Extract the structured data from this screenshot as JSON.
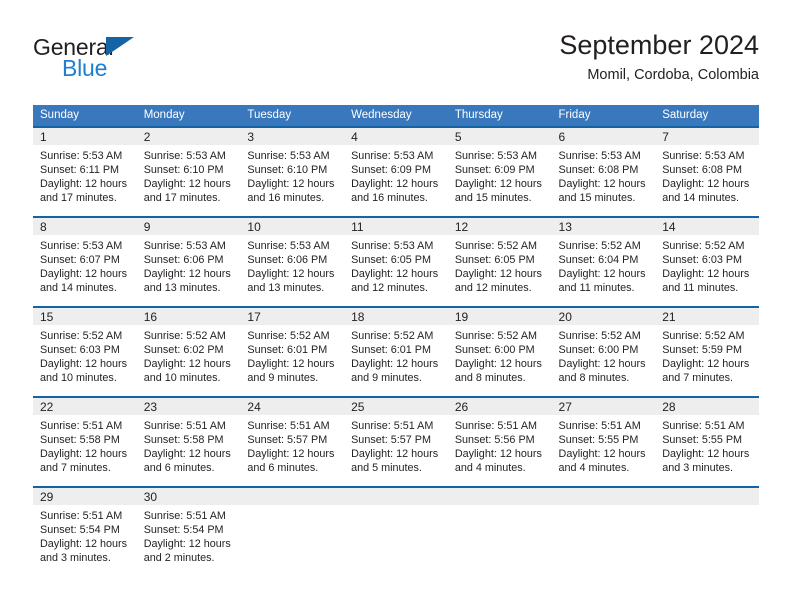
{
  "logo": {
    "text_top": "General",
    "text_bottom": "Blue",
    "triangle_icon": "blue-triangle-icon",
    "color_dark": "#231f20",
    "color_blue": "#1f7ed0"
  },
  "header": {
    "title": "September 2024",
    "subtitle": "Momil, Cordoba, Colombia"
  },
  "theme": {
    "header_row_bg": "#3a78bd",
    "week_separator": "#1464a5",
    "daynum_band_bg": "#eeeeee",
    "text": "#231f20"
  },
  "columns": [
    "Sunday",
    "Monday",
    "Tuesday",
    "Wednesday",
    "Thursday",
    "Friday",
    "Saturday"
  ],
  "weeks": [
    [
      {
        "day": "1",
        "lines": [
          "Sunrise: 5:53 AM",
          "Sunset: 6:11 PM",
          "Daylight: 12 hours",
          "and 17 minutes."
        ]
      },
      {
        "day": "2",
        "lines": [
          "Sunrise: 5:53 AM",
          "Sunset: 6:10 PM",
          "Daylight: 12 hours",
          "and 17 minutes."
        ]
      },
      {
        "day": "3",
        "lines": [
          "Sunrise: 5:53 AM",
          "Sunset: 6:10 PM",
          "Daylight: 12 hours",
          "and 16 minutes."
        ]
      },
      {
        "day": "4",
        "lines": [
          "Sunrise: 5:53 AM",
          "Sunset: 6:09 PM",
          "Daylight: 12 hours",
          "and 16 minutes."
        ]
      },
      {
        "day": "5",
        "lines": [
          "Sunrise: 5:53 AM",
          "Sunset: 6:09 PM",
          "Daylight: 12 hours",
          "and 15 minutes."
        ]
      },
      {
        "day": "6",
        "lines": [
          "Sunrise: 5:53 AM",
          "Sunset: 6:08 PM",
          "Daylight: 12 hours",
          "and 15 minutes."
        ]
      },
      {
        "day": "7",
        "lines": [
          "Sunrise: 5:53 AM",
          "Sunset: 6:08 PM",
          "Daylight: 12 hours",
          "and 14 minutes."
        ]
      }
    ],
    [
      {
        "day": "8",
        "lines": [
          "Sunrise: 5:53 AM",
          "Sunset: 6:07 PM",
          "Daylight: 12 hours",
          "and 14 minutes."
        ]
      },
      {
        "day": "9",
        "lines": [
          "Sunrise: 5:53 AM",
          "Sunset: 6:06 PM",
          "Daylight: 12 hours",
          "and 13 minutes."
        ]
      },
      {
        "day": "10",
        "lines": [
          "Sunrise: 5:53 AM",
          "Sunset: 6:06 PM",
          "Daylight: 12 hours",
          "and 13 minutes."
        ]
      },
      {
        "day": "11",
        "lines": [
          "Sunrise: 5:53 AM",
          "Sunset: 6:05 PM",
          "Daylight: 12 hours",
          "and 12 minutes."
        ]
      },
      {
        "day": "12",
        "lines": [
          "Sunrise: 5:52 AM",
          "Sunset: 6:05 PM",
          "Daylight: 12 hours",
          "and 12 minutes."
        ]
      },
      {
        "day": "13",
        "lines": [
          "Sunrise: 5:52 AM",
          "Sunset: 6:04 PM",
          "Daylight: 12 hours",
          "and 11 minutes."
        ]
      },
      {
        "day": "14",
        "lines": [
          "Sunrise: 5:52 AM",
          "Sunset: 6:03 PM",
          "Daylight: 12 hours",
          "and 11 minutes."
        ]
      }
    ],
    [
      {
        "day": "15",
        "lines": [
          "Sunrise: 5:52 AM",
          "Sunset: 6:03 PM",
          "Daylight: 12 hours",
          "and 10 minutes."
        ]
      },
      {
        "day": "16",
        "lines": [
          "Sunrise: 5:52 AM",
          "Sunset: 6:02 PM",
          "Daylight: 12 hours",
          "and 10 minutes."
        ]
      },
      {
        "day": "17",
        "lines": [
          "Sunrise: 5:52 AM",
          "Sunset: 6:01 PM",
          "Daylight: 12 hours",
          "and 9 minutes."
        ]
      },
      {
        "day": "18",
        "lines": [
          "Sunrise: 5:52 AM",
          "Sunset: 6:01 PM",
          "Daylight: 12 hours",
          "and 9 minutes."
        ]
      },
      {
        "day": "19",
        "lines": [
          "Sunrise: 5:52 AM",
          "Sunset: 6:00 PM",
          "Daylight: 12 hours",
          "and 8 minutes."
        ]
      },
      {
        "day": "20",
        "lines": [
          "Sunrise: 5:52 AM",
          "Sunset: 6:00 PM",
          "Daylight: 12 hours",
          "and 8 minutes."
        ]
      },
      {
        "day": "21",
        "lines": [
          "Sunrise: 5:52 AM",
          "Sunset: 5:59 PM",
          "Daylight: 12 hours",
          "and 7 minutes."
        ]
      }
    ],
    [
      {
        "day": "22",
        "lines": [
          "Sunrise: 5:51 AM",
          "Sunset: 5:58 PM",
          "Daylight: 12 hours",
          "and 7 minutes."
        ]
      },
      {
        "day": "23",
        "lines": [
          "Sunrise: 5:51 AM",
          "Sunset: 5:58 PM",
          "Daylight: 12 hours",
          "and 6 minutes."
        ]
      },
      {
        "day": "24",
        "lines": [
          "Sunrise: 5:51 AM",
          "Sunset: 5:57 PM",
          "Daylight: 12 hours",
          "and 6 minutes."
        ]
      },
      {
        "day": "25",
        "lines": [
          "Sunrise: 5:51 AM",
          "Sunset: 5:57 PM",
          "Daylight: 12 hours",
          "and 5 minutes."
        ]
      },
      {
        "day": "26",
        "lines": [
          "Sunrise: 5:51 AM",
          "Sunset: 5:56 PM",
          "Daylight: 12 hours",
          "and 4 minutes."
        ]
      },
      {
        "day": "27",
        "lines": [
          "Sunrise: 5:51 AM",
          "Sunset: 5:55 PM",
          "Daylight: 12 hours",
          "and 4 minutes."
        ]
      },
      {
        "day": "28",
        "lines": [
          "Sunrise: 5:51 AM",
          "Sunset: 5:55 PM",
          "Daylight: 12 hours",
          "and 3 minutes."
        ]
      }
    ],
    [
      {
        "day": "29",
        "lines": [
          "Sunrise: 5:51 AM",
          "Sunset: 5:54 PM",
          "Daylight: 12 hours",
          "and 3 minutes."
        ]
      },
      {
        "day": "30",
        "lines": [
          "Sunrise: 5:51 AM",
          "Sunset: 5:54 PM",
          "Daylight: 12 hours",
          "and 2 minutes."
        ]
      },
      {
        "day": "",
        "lines": []
      },
      {
        "day": "",
        "lines": []
      },
      {
        "day": "",
        "lines": []
      },
      {
        "day": "",
        "lines": []
      },
      {
        "day": "",
        "lines": []
      }
    ]
  ]
}
